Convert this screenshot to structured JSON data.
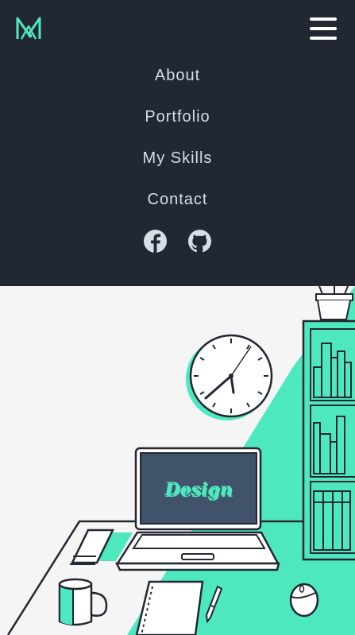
{
  "header": {
    "logo_icon": "monogram-m-logo",
    "menu_icon": "hamburger-icon"
  },
  "nav": {
    "items": [
      {
        "label": "About"
      },
      {
        "label": "Portfolio"
      },
      {
        "label": "My Skills"
      },
      {
        "label": "Contact"
      }
    ]
  },
  "social": {
    "icons": [
      "facebook-icon",
      "github-icon"
    ]
  },
  "illustration": {
    "screen_text": "Design"
  },
  "colors": {
    "header_bg": "#212733",
    "nav_text": "#d9dee6",
    "accent": "#4ee8bf",
    "line": "#222733",
    "screen": "#41536a",
    "background": "#f5f5f5"
  }
}
